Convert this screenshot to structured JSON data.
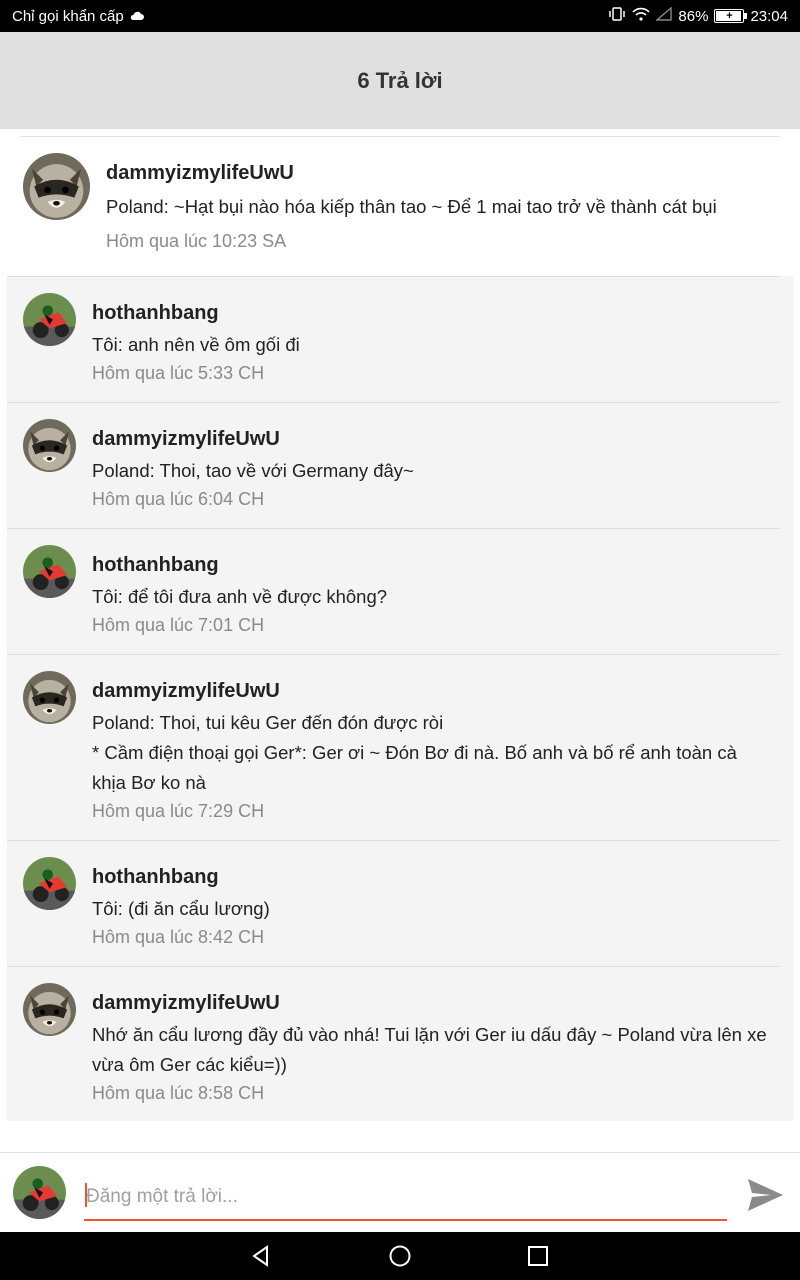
{
  "status_bar": {
    "carrier": "Chỉ gọi khẩn cấp",
    "battery": "86%",
    "battery_level": 0.86,
    "time": "23:04",
    "icons": [
      "cloud-icon",
      "vibrate-icon",
      "wifi-icon",
      "signal-icon",
      "battery-icon"
    ]
  },
  "header": {
    "title": "6 Trả lời"
  },
  "post": {
    "author": "dammyizmylifeUwU",
    "text": "Poland: ~Hạt bụi nào hóa kiếp thân tao ~ Để 1 mai tao trở về thành cát bụi",
    "time": "Hôm qua lúc 10:23 SA",
    "avatar": "raccoon-avatar"
  },
  "replies": [
    {
      "author": "hothanhbang",
      "avatar": "motorbike-avatar",
      "lines": [
        "Tôi: anh nên về ôm gối đi"
      ],
      "time": "Hôm qua lúc 5:33 CH"
    },
    {
      "author": "dammyizmylifeUwU",
      "avatar": "raccoon-avatar",
      "lines": [
        "Poland: Thoi, tao về với Germany đây~"
      ],
      "time": "Hôm qua lúc 6:04 CH"
    },
    {
      "author": "hothanhbang",
      "avatar": "motorbike-avatar",
      "lines": [
        "Tôi: để tôi đưa anh về được không?"
      ],
      "time": "Hôm qua lúc 7:01 CH"
    },
    {
      "author": "dammyizmylifeUwU",
      "avatar": "raccoon-avatar",
      "lines": [
        "Poland: Thoi, tui kêu Ger đến đón được ròi",
        "* Cầm điện thoại gọi Ger*: Ger ơi ~ Đón Bơ đi nà. Bố anh và bố rể anh toàn cà",
        "khịa Bơ ko nà"
      ],
      "time": "Hôm qua lúc 7:29 CH"
    },
    {
      "author": "hothanhbang",
      "avatar": "motorbike-avatar",
      "lines": [
        "Tôi: (đi ăn cẩu lương)"
      ],
      "time": "Hôm qua lúc 8:42 CH"
    },
    {
      "author": "dammyizmylifeUwU",
      "avatar": "raccoon-avatar",
      "lines": [
        "Nhớ ăn cẩu lương đầy đủ vào nhá! Tui lặn với Ger iu dấu đây ~ Poland vừa lên xe",
        "vừa ôm Ger các kiểu=))"
      ],
      "time": "Hôm qua lúc 8:58 CH"
    }
  ],
  "input": {
    "placeholder": "Đăng một trả lời...",
    "value": ""
  },
  "colors": {
    "accent": "#e8582c",
    "header_bg": "#e0e0e0",
    "reply_bg": "#f4f4f4"
  },
  "nav": {
    "icons": [
      "back-icon",
      "home-icon",
      "recents-icon"
    ]
  }
}
